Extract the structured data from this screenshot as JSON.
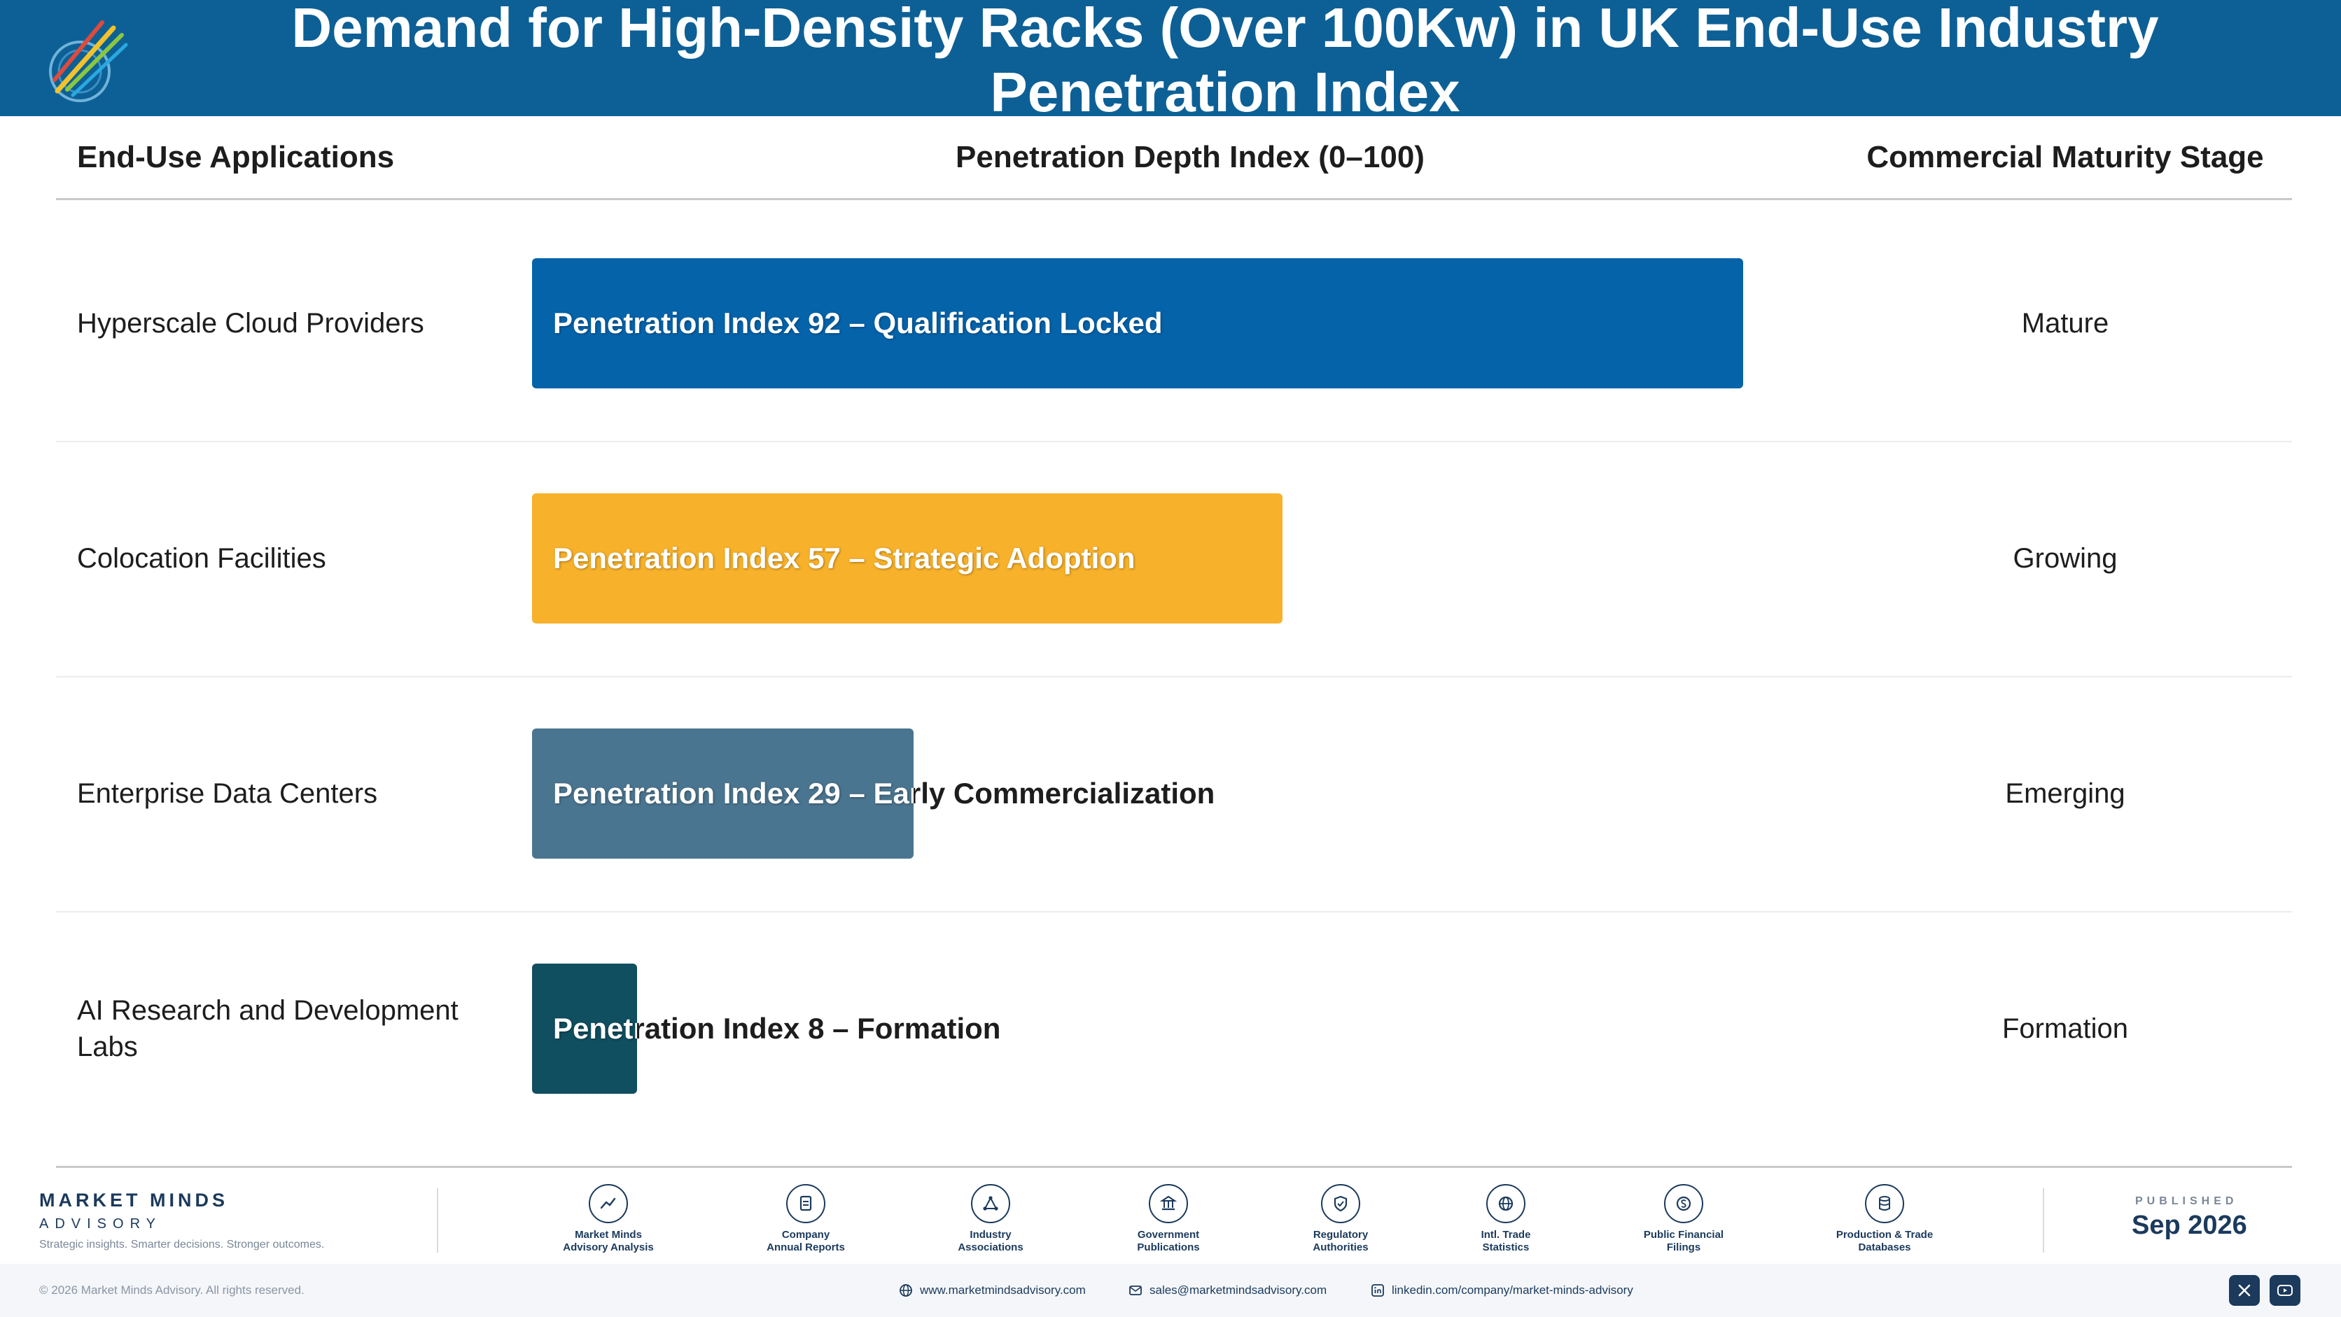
{
  "header": {
    "title_line1": "Demand for High-Density Racks (Over 100Kw) in UK End-Use Industry",
    "title_line2": "Penetration Index",
    "logo_text": "Market Minds Advisory"
  },
  "columns": {
    "applications": "End-Use Applications",
    "depth": "Penetration Depth Index (0–100)",
    "stage": "Commercial Maturity Stage"
  },
  "chart_data": {
    "type": "bar",
    "orientation": "horizontal",
    "categories": [
      "Hyperscale Cloud Providers",
      "Colocation Facilities",
      "Enterprise Data Centers",
      "AI Research and Development Labs"
    ],
    "values": [
      92,
      57,
      29,
      8
    ],
    "xlim": [
      0,
      100
    ],
    "bar_labels": [
      "Penetration Index 92 – Qualification Locked",
      "Penetration Index 57 – Strategic Adoption",
      "Penetration Index 29 – Early Commercialization",
      "Penetration Index 8 – Formation"
    ],
    "stages": [
      "Mature",
      "Growing",
      "Emerging",
      "Formation"
    ],
    "colors": [
      "#0563aa",
      "#f7b12a",
      "#4a7590",
      "#0f4f5f"
    ],
    "label_colors": [
      "#ffffff",
      "#ffffff",
      "#ffffff",
      "#ffffff"
    ],
    "outside_label_color": "#1d1d1d"
  },
  "footer": {
    "brand_name": "MARKET MINDS",
    "brand_sub": "ADVISORY",
    "brand_tag": "Strategic insights. Smarter decisions. Stronger outcomes.",
    "sources": [
      {
        "line1": "Market Minds",
        "line2": "Advisory Analysis",
        "icon": "chart-icon"
      },
      {
        "line1": "Company",
        "line2": "Annual Reports",
        "icon": "document-icon"
      },
      {
        "line1": "Industry",
        "line2": "Associations",
        "icon": "network-icon"
      },
      {
        "line1": "Government",
        "line2": "Publications",
        "icon": "building-icon"
      },
      {
        "line1": "Regulatory",
        "line2": "Authorities",
        "icon": "shield-icon"
      },
      {
        "line1": "Intl. Trade",
        "line2": "Statistics",
        "icon": "globe-icon"
      },
      {
        "line1": "Public Financial",
        "line2": "Filings",
        "icon": "coin-icon"
      },
      {
        "line1": "Production & Trade",
        "line2": "Databases",
        "icon": "database-icon"
      }
    ],
    "published_label": "PUBLISHED",
    "published_date": "Sep 2026",
    "copyright": "© 2026 Market Minds Advisory. All rights reserved.",
    "website": "www.marketmindsadvisory.com",
    "email": "sales@marketmindsadvisory.com",
    "linkedin": "linkedin.com/company/market-minds-advisory"
  }
}
